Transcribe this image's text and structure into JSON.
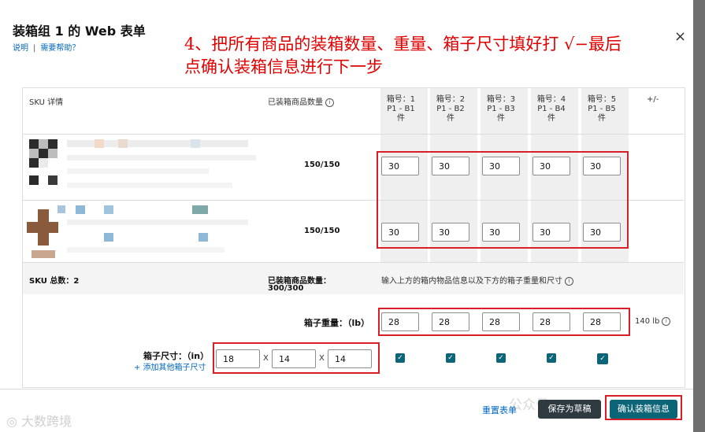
{
  "dialog": {
    "title": "装箱组 1 的 Web 表单",
    "links": [
      "说明",
      "需要帮助？"
    ],
    "close_icon": "×"
  },
  "annotation": {
    "line1": "4、把所有商品的装箱数量、重量、箱子尺寸填好打 √−最后",
    "line2": "点确认装箱信息进行下一步"
  },
  "table": {
    "sku_header": "SKU 详情",
    "qty_header": "已装箱商品数量",
    "info_icon": "i",
    "add_remove": "+/-",
    "boxes": [
      {
        "l1": "箱号：1",
        "l2": "P1 - B1",
        "l3": "件"
      },
      {
        "l1": "箱号：2",
        "l2": "P1 - B2",
        "l3": "件"
      },
      {
        "l1": "箱号：3",
        "l2": "P1 - B3",
        "l3": "件"
      },
      {
        "l1": "箱号：4",
        "l2": "P1 - B4",
        "l3": "件"
      },
      {
        "l1": "箱号：5",
        "l2": "P1 - B5",
        "l3": "件"
      }
    ],
    "rows": [
      {
        "qty": "150/150",
        "values": [
          "30",
          "30",
          "30",
          "30",
          "30"
        ]
      },
      {
        "qty": "150/150",
        "values": [
          "30",
          "30",
          "30",
          "30",
          "30"
        ]
      }
    ]
  },
  "summary": {
    "sku_total": "SKU 总数：2",
    "packed_label": "已装箱商品数量：",
    "packed_value": "300/300",
    "hint": "输入上方的箱内物品信息以及下方的箱子重量和尺寸"
  },
  "weight": {
    "label": "箱子重量：（lb）",
    "values": [
      "28",
      "28",
      "28",
      "28",
      "28"
    ],
    "total": "140 lb"
  },
  "dimensions": {
    "label": "箱子尺寸：（in）",
    "add_link": "+ 添加其他箱子尺寸",
    "values": [
      "18",
      "14",
      "14"
    ],
    "separator": "X",
    "check_mark": "✓"
  },
  "footer": {
    "reset": "重置表单",
    "save_draft": "保存为草稿",
    "confirm": "确认装箱信息"
  },
  "watermarks": {
    "bottom_left": "大数跨境",
    "account": "公众号"
  }
}
